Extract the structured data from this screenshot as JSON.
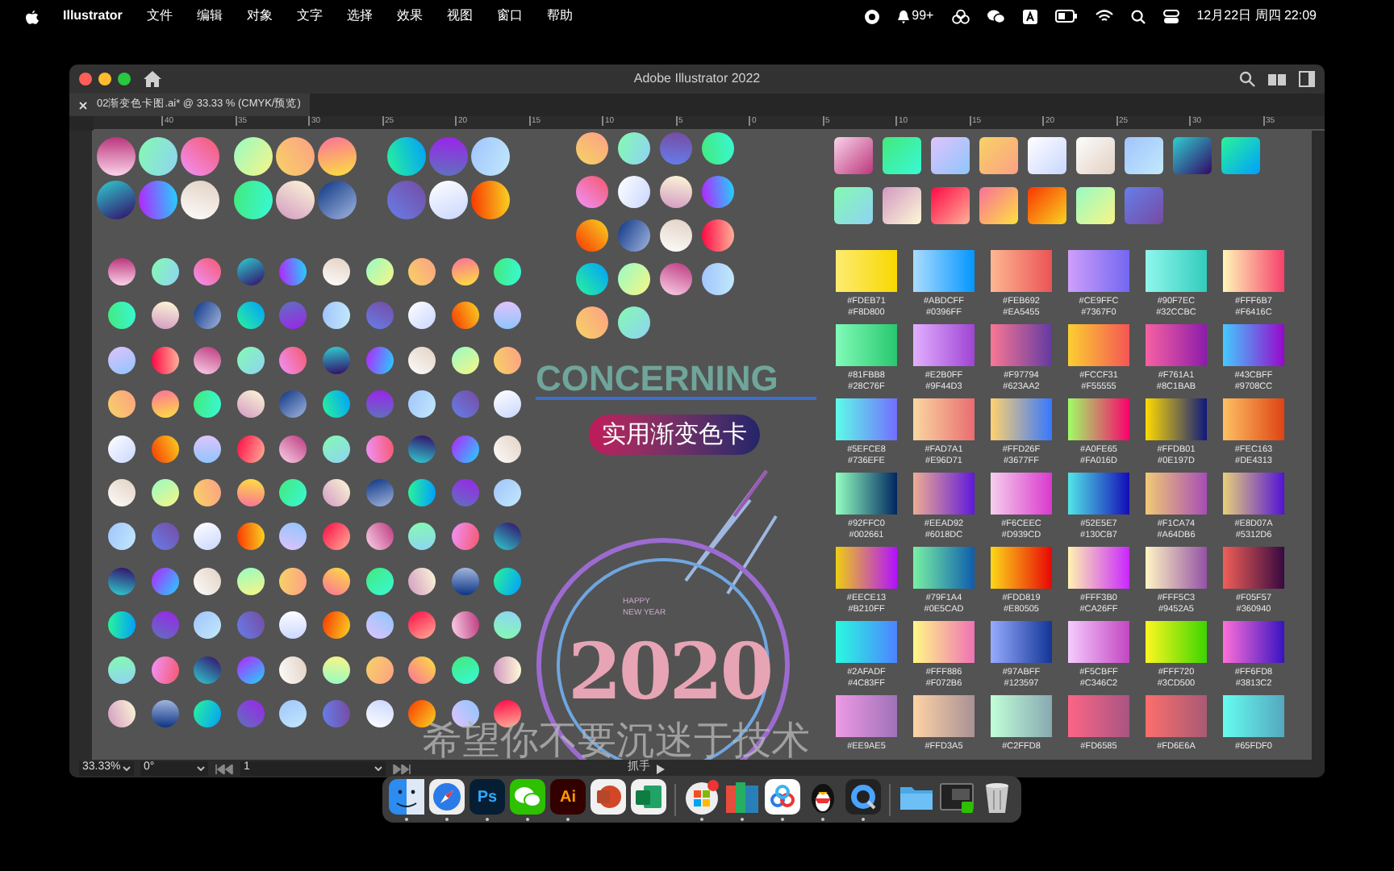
{
  "menu_bar": {
    "app": "Illustrator",
    "items": [
      "文件",
      "编辑",
      "对象",
      "文字",
      "选择",
      "效果",
      "视图",
      "窗口",
      "帮助"
    ],
    "notification_count": "99+",
    "clock": "12月22日 周四 22:09"
  },
  "window": {
    "title": "Adobe Illustrator 2022"
  },
  "tabs": [
    {
      "label": "02渐变色卡图.ai* @ 33.33 % (CMYK/预览)",
      "selected": true
    }
  ],
  "ruler": {
    "labels": [
      "40",
      "35",
      "30",
      "25",
      "20",
      "15",
      "10",
      "5",
      "0",
      "5",
      "10",
      "15",
      "20",
      "25",
      "30",
      "35"
    ]
  },
  "artboard": {
    "headline": "CONCERNING",
    "badge": "实用渐变色卡",
    "greeting": [
      "HAPPY",
      "NEW YEAR"
    ],
    "year": "2020",
    "swatches": [
      {
        "codes": [
          "#FDEB71",
          "#F8D800"
        ]
      },
      {
        "codes": [
          "#ABDCFF",
          "#0396FF"
        ]
      },
      {
        "codes": [
          "#FEB692",
          "#EA5455"
        ]
      },
      {
        "codes": [
          "#CE9FFC",
          "#7367F0"
        ]
      },
      {
        "codes": [
          "#90F7EC",
          "#32CCBC"
        ]
      },
      {
        "codes": [
          "#FFF6B7",
          "#F6416C"
        ]
      },
      {
        "codes": [
          "#81FBB8",
          "#28C76F"
        ]
      },
      {
        "codes": [
          "#E2B0FF",
          "#9F44D3"
        ]
      },
      {
        "codes": [
          "#F97794",
          "#623AA2"
        ]
      },
      {
        "codes": [
          "#FCCF31",
          "#F55555"
        ]
      },
      {
        "codes": [
          "#F761A1",
          "#8C1BAB"
        ]
      },
      {
        "codes": [
          "#43CBFF",
          "#9708CC"
        ]
      },
      {
        "codes": [
          "#5EFCE8",
          "#736EFE"
        ]
      },
      {
        "codes": [
          "#FAD7A1",
          "#E96D71"
        ]
      },
      {
        "codes": [
          "#FFD26F",
          "#3677FF"
        ]
      },
      {
        "codes": [
          "#A0FE65",
          "#FA016D"
        ]
      },
      {
        "codes": [
          "#FFDB01",
          "#0E197D"
        ]
      },
      {
        "codes": [
          "#FEC163",
          "#DE4313"
        ]
      },
      {
        "codes": [
          "#92FFC0",
          "#002661"
        ]
      },
      {
        "codes": [
          "#EEAD92",
          "#6018DC"
        ]
      },
      {
        "codes": [
          "#F6CEEC",
          "#D939CD"
        ]
      },
      {
        "codes": [
          "#52E5E7",
          "#130CB7"
        ]
      },
      {
        "codes": [
          "#F1CA74",
          "#A64DB6"
        ]
      },
      {
        "codes": [
          "#E8D07A",
          "#5312D6"
        ]
      },
      {
        "codes": [
          "#EECE13",
          "#B210FF"
        ]
      },
      {
        "codes": [
          "#79F1A4",
          "#0E5CAD"
        ]
      },
      {
        "codes": [
          "#FDD819",
          "#E80505"
        ]
      },
      {
        "codes": [
          "#FFF3B0",
          "#CA26FF"
        ]
      },
      {
        "codes": [
          "#FFF5C3",
          "#9452A5"
        ]
      },
      {
        "codes": [
          "#F05F57",
          "#360940"
        ]
      },
      {
        "codes": [
          "#2AFADF",
          "#4C83FF"
        ]
      },
      {
        "codes": [
          "#FFF886",
          "#F072B6"
        ]
      },
      {
        "codes": [
          "#97ABFF",
          "#123597"
        ]
      },
      {
        "codes": [
          "#F5CBFF",
          "#C346C2"
        ]
      },
      {
        "codes": [
          "#FFF720",
          "#3CD500"
        ]
      },
      {
        "codes": [
          "#FF6FD8",
          "#3813C2"
        ]
      },
      {
        "codes": [
          "#EE9AE5"
        ]
      },
      {
        "codes": [
          "#FFD3A5"
        ]
      },
      {
        "codes": [
          "#C2FFD8"
        ]
      },
      {
        "codes": [
          "#FD6585"
        ]
      },
      {
        "codes": [
          "#FD6E6A"
        ]
      },
      {
        "codes": [
          "#65FDF0"
        ]
      }
    ]
  },
  "subtitle": "希望你不要沉迷于技术",
  "status_bar": {
    "zoom": "33.33%",
    "rotation": "0°",
    "artboard_number": "1",
    "tool": "抓手"
  },
  "dock": {
    "items": [
      {
        "kind": "finder",
        "running": true
      },
      {
        "kind": "browser",
        "running": true
      },
      {
        "kind": "ps",
        "label": "Ps",
        "running": true
      },
      {
        "kind": "chat",
        "running": true
      },
      {
        "kind": "ai",
        "label": "Ai",
        "running": true
      },
      {
        "kind": "slides",
        "running": false
      },
      {
        "kind": "sheet",
        "running": false
      },
      {
        "kind": "store",
        "running": true
      },
      {
        "kind": "books",
        "running": true
      },
      {
        "kind": "cloud",
        "running": true
      },
      {
        "kind": "penguin",
        "running": true
      },
      {
        "kind": "player",
        "running": true
      },
      {
        "kind": "folder",
        "running": false
      },
      {
        "kind": "screenshot",
        "running": false
      },
      {
        "kind": "trash",
        "running": false
      }
    ]
  }
}
